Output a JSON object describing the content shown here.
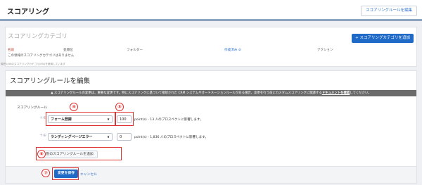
{
  "header": {
    "title": "スコアリング",
    "edit_rules_label": "スコアリングルールを編集"
  },
  "category": {
    "title": "スコアリングカテゴリ",
    "add_label": "+ スコアリングカテゴリを追加",
    "columns": [
      "名前",
      "並順位",
      "フォルダー",
      "作成済み ⊘",
      "アクション"
    ],
    "empty_text": "この領域のスコアリングカテゴリはありません",
    "note": "現在0/40のスコアリングカテゴリ(0%)を使用しています"
  },
  "rules": {
    "title": "スコアリングルールを編集",
    "warning_prefix": "▲ スコアリングルールの変更は、重要な変更です。特にスコアリングに基づいて接続された CRM システムやオートメーションルールがある場合、変更を行う前にカスタムスコアリングに関連する",
    "warning_link": "ドキュメントを確認",
    "warning_suffix": "してください。",
    "rule_label": "スコアリングルール",
    "rows": [
      {
        "select_value": "フォーム登録",
        "points": "100",
        "impact": "point(s) - 13 人のプロスペクトに影響します。"
      },
      {
        "select_value": "ランディングページエラー",
        "points": "0",
        "impact": "point(s) - 1,836 人のプロスペクトに影響します。"
      }
    ],
    "add_rule_label": "+ 別のスコアリングルールを追加",
    "save_label": "変更を保存",
    "cancel_label": "キャンセル"
  },
  "annotations": [
    "④",
    "⑤",
    "⑥",
    "⑦"
  ],
  "colors": {
    "accent": "#1e6ac6",
    "annotation": "#e03131",
    "warning_bg": "#6b6b6b"
  },
  "icons": {
    "plus": "+",
    "chevron": "∨"
  }
}
